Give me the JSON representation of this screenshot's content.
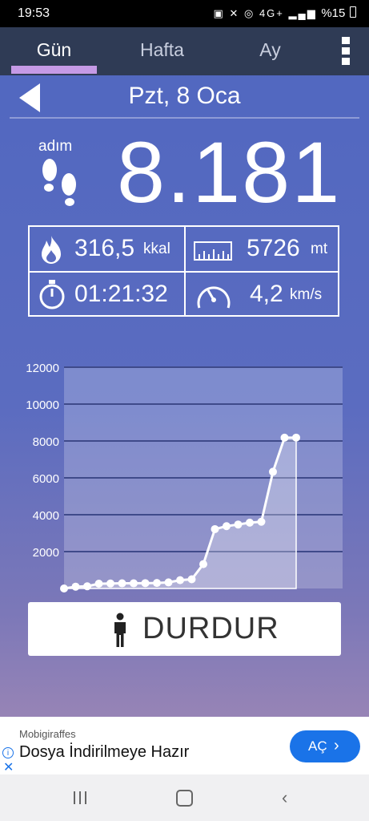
{
  "status_bar": {
    "time": "19:53",
    "signal": "4G+",
    "battery": "%15"
  },
  "tabs": [
    {
      "label": "Gün",
      "active": true
    },
    {
      "label": "Hafta",
      "active": false
    },
    {
      "label": "Ay",
      "active": false
    }
  ],
  "date": "Pzt, 8 Oca",
  "steps": {
    "label": "adım",
    "value": "8.181"
  },
  "stats": {
    "calories": {
      "value": "316,5",
      "unit": "kkal",
      "icon": "flame-icon"
    },
    "distance": {
      "value": "5726",
      "unit": "mt",
      "icon": "ruler-icon"
    },
    "duration": {
      "value": "01:21:32",
      "icon": "stopwatch-icon"
    },
    "speed": {
      "value": "4,2",
      "unit": "km/s",
      "icon": "speedometer-icon"
    }
  },
  "chart_data": {
    "type": "area",
    "x": [
      0,
      1,
      2,
      3,
      4,
      5,
      6,
      7,
      8,
      9,
      10,
      11,
      12,
      13,
      14,
      15,
      16,
      17,
      18,
      19,
      20
    ],
    "values": [
      0,
      100,
      120,
      260,
      270,
      280,
      280,
      290,
      300,
      330,
      450,
      500,
      1320,
      3220,
      3380,
      3470,
      3570,
      3620,
      6330,
      8180,
      8181
    ],
    "y_ticks": [
      "2000",
      "4000",
      "6000",
      "8000",
      "10000",
      "12000"
    ],
    "x_ticks": [
      "2",
      "4",
      "6",
      "8",
      "10",
      "12",
      "14",
      "16",
      "18",
      "20",
      "22",
      "24"
    ],
    "ylim": [
      0,
      12000
    ],
    "xlim": [
      0,
      24
    ],
    "grid": true
  },
  "stop_button": {
    "label": "DURDUR",
    "icon": "person-icon"
  },
  "ad": {
    "advertiser": "Mobigiraffes",
    "title": "Dosya İndirilmeye Hazır",
    "cta": "AÇ"
  }
}
